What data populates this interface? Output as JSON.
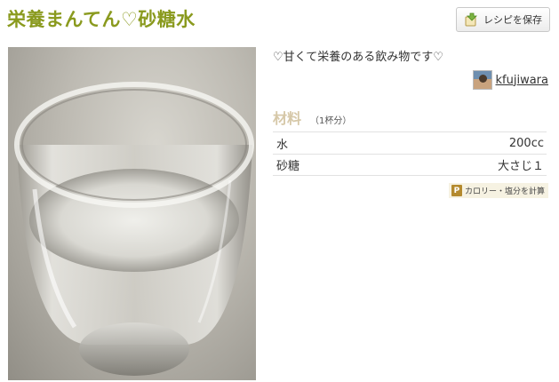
{
  "recipe": {
    "title": "栄養まんてん♡砂糖水",
    "description": "♡甘くて栄養のある飲み物です♡"
  },
  "actions": {
    "save_label": "レシピを保存",
    "save_icon": "save-recipe-icon"
  },
  "author": {
    "name": "kfujiwara"
  },
  "ingredients": {
    "heading": "材料",
    "servings": "（1杯分）",
    "items": [
      {
        "name": "水",
        "amount": "200cc"
      },
      {
        "name": "砂糖",
        "amount": "大さじ１"
      }
    ]
  },
  "calorie": {
    "label": "カロリー・塩分を計算",
    "icon_letter": "P"
  },
  "colors": {
    "title": "#8a9a1e",
    "ingredients_heading": "#d6c8a8",
    "calc_icon": "#b48a2e"
  }
}
